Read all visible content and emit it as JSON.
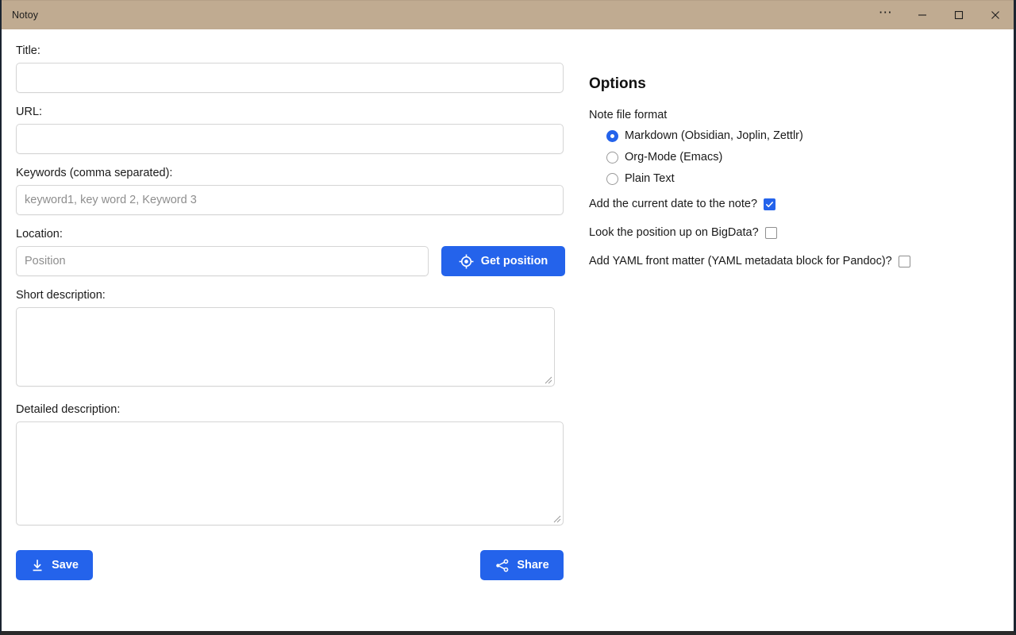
{
  "window": {
    "title": "Notoy",
    "titlebar_color": "#c0ab91",
    "accent_color": "#2463eb",
    "controls": [
      {
        "name": "more-options",
        "glyph": "…"
      },
      {
        "name": "minimize",
        "glyph": "—"
      },
      {
        "name": "maximize",
        "glyph": "□"
      },
      {
        "name": "close",
        "glyph": "✕"
      }
    ]
  },
  "form": {
    "title": {
      "label": "Title:",
      "value": "",
      "placeholder": ""
    },
    "url": {
      "label": "URL:",
      "value": "",
      "placeholder": ""
    },
    "keywords": {
      "label": "Keywords (comma separated):",
      "value": "",
      "placeholder": "keyword1, key word 2, Keyword 3"
    },
    "location": {
      "label": "Location:",
      "value": "",
      "placeholder": "Position",
      "button_label": "Get position",
      "button_icon": "crosshair-target-icon"
    },
    "short_description": {
      "label": "Short description:",
      "value": "",
      "placeholder": ""
    },
    "detailed_description": {
      "label": "Detailed description:",
      "value": "",
      "placeholder": ""
    },
    "actions": {
      "save": {
        "label": "Save",
        "icon": "download-icon"
      },
      "share": {
        "label": "Share",
        "icon": "share-nodes-icon"
      }
    }
  },
  "options": {
    "heading": "Options",
    "note_format": {
      "legend": "Note file format",
      "items": [
        {
          "label": "Markdown (Obsidian, Joplin, Zettlr)",
          "checked": true
        },
        {
          "label": "Org-Mode (Emacs)",
          "checked": false
        },
        {
          "label": "Plain Text",
          "checked": false
        }
      ]
    },
    "checkboxes": [
      {
        "label": "Add the current date to the note?",
        "checked": true
      },
      {
        "label": "Look the position up on BigData?",
        "checked": false
      },
      {
        "label": "Add YAML front matter (YAML metadata block for Pandoc)?",
        "checked": false
      }
    ]
  }
}
